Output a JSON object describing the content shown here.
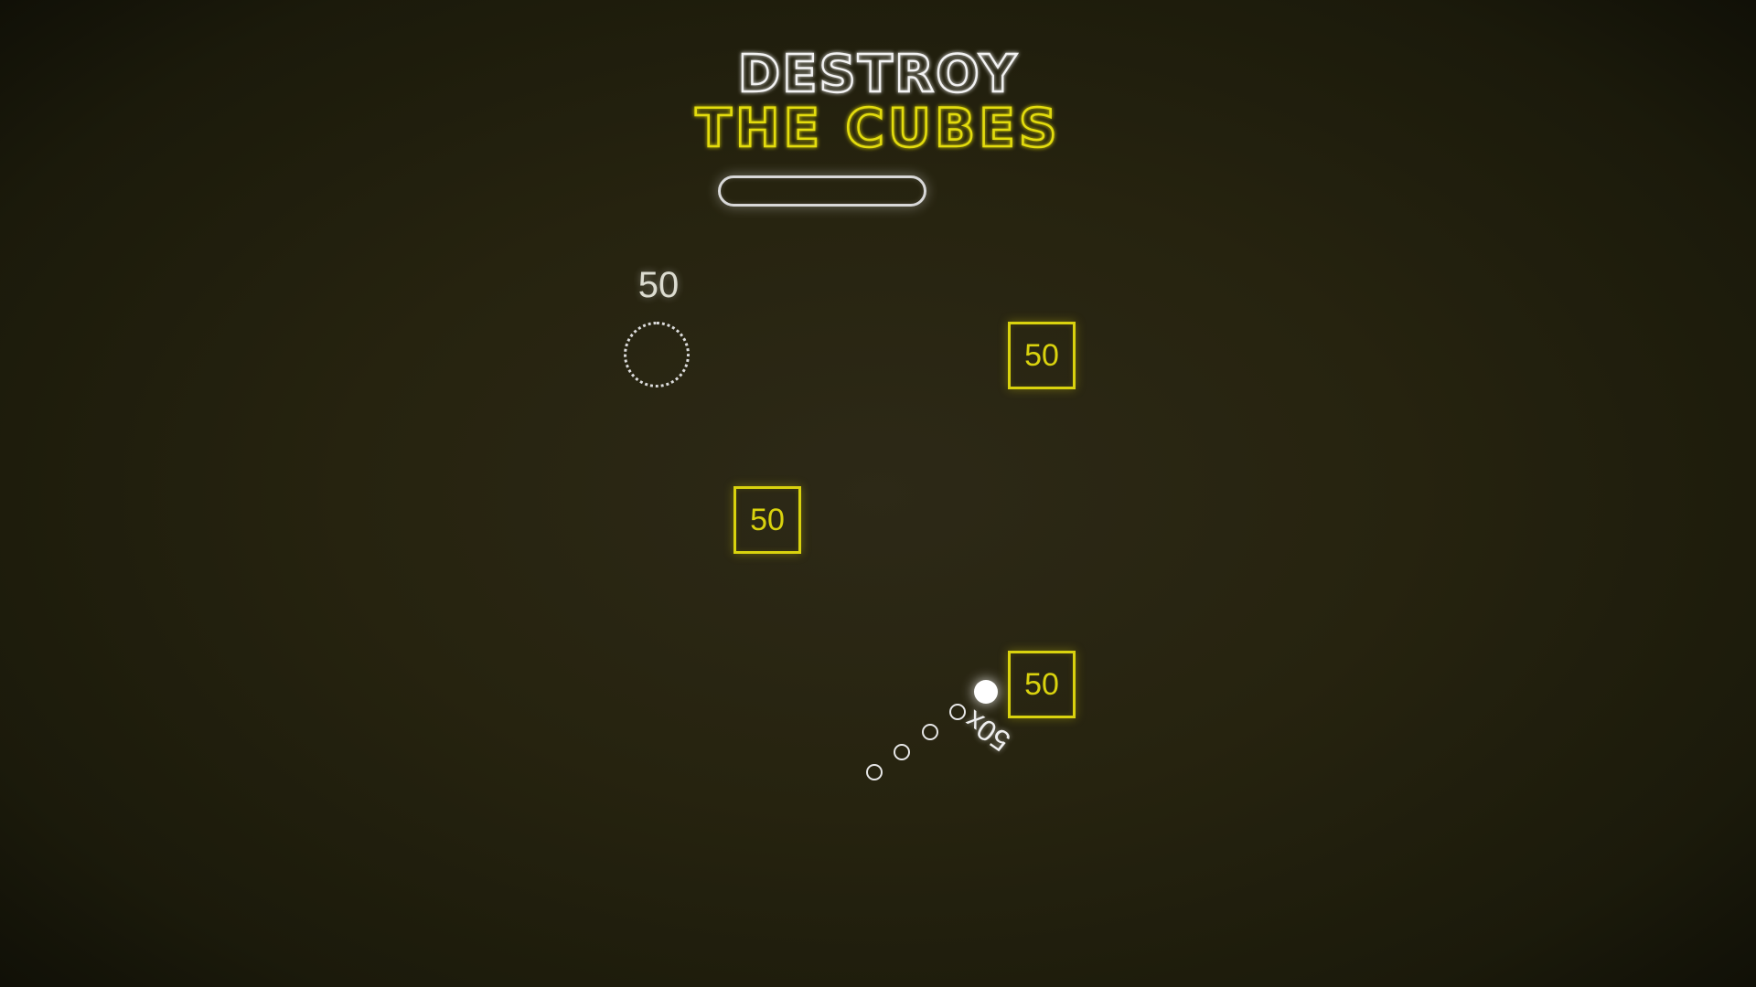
{
  "title": {
    "line1": "DESTROY",
    "line2": "THE CUBES",
    "line1_color": "#f2f2f2",
    "line2_color": "#e3dc10"
  },
  "level_progress": {
    "fraction": 0.0
  },
  "spawn_point": {
    "score_label": "50"
  },
  "cubes": [
    {
      "value": "50"
    },
    {
      "value": "50"
    },
    {
      "value": "50"
    }
  ],
  "ball": {
    "count_label": "50x"
  },
  "colors": {
    "cube_yellow": "#d9d20e",
    "background": "#26230f",
    "white_glow": "#ffffff"
  }
}
